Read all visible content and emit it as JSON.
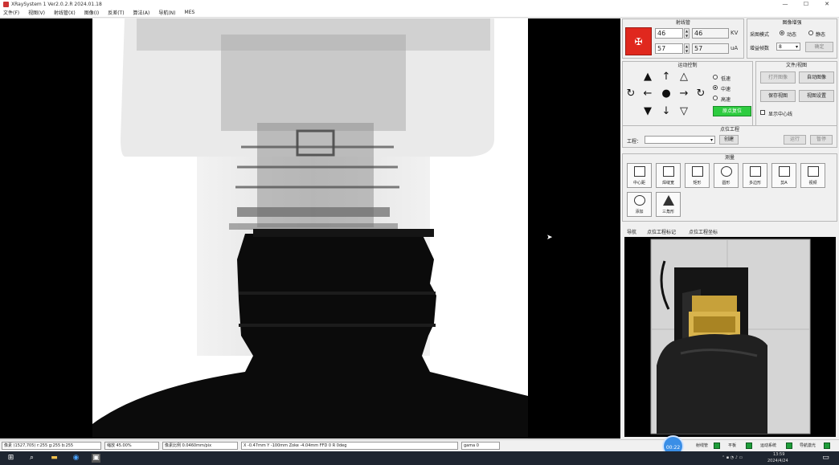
{
  "window": {
    "title": "XRaySystem 1 Ver2.0.2.R 2024.01.18",
    "minimize": "—",
    "maximize": "☐",
    "close": "✕"
  },
  "menu": [
    "文件(F)",
    "视图(V)",
    "射线管(X)",
    "图像(I)",
    "反差(T)",
    "算法(A)",
    "导航(N)",
    "MES"
  ],
  "tube": {
    "title": "射线管",
    "kv_set": "46",
    "kv_actual": "46",
    "kv_unit": "KV",
    "ua_set": "57",
    "ua_actual": "57",
    "ua_unit": "uA",
    "xray_symbol": "✠"
  },
  "image_enhance": {
    "title": "图像增强",
    "mode_label": "采图模式",
    "mode_dynamic": "动态",
    "mode_static": "静态",
    "frames_label": "增益帧数",
    "frames_value": "8",
    "apply_label": "确定"
  },
  "motion": {
    "title": "运动控制",
    "speed_slow": "低速",
    "speed_mid": "中速",
    "speed_high": "高速",
    "reset_label": "原点复位"
  },
  "file_view": {
    "title": "文件/视图",
    "open_image": "打开图像",
    "auto_save": "自动图像",
    "save_image": "保存视图",
    "view_settings": "视图设置",
    "show_center": "显示中心线"
  },
  "project": {
    "title": "点位工程",
    "label": "工程：",
    "create": "创建",
    "load": "运行",
    "stop": "暂停"
  },
  "measure": {
    "title": "测量",
    "tools": [
      "中心距",
      "焊缝宽",
      "矩形",
      "圆形",
      "多边形",
      "剪A",
      "视频",
      "添加",
      "三角形"
    ]
  },
  "tabs": [
    "导航",
    "点位工程标记",
    "点位工程坐标"
  ],
  "status": {
    "pixel": "像素 (1527,705) r:255 g:255 b:255",
    "zoom": "缩放 45.00%",
    "scale": "像素比例 0.0460mm/pix",
    "coords": "X -0.47mm  Y -100mm  Zoke -4.04mm  FFD 0  R 0deg",
    "gamma": "gama 0",
    "badge": "00:22",
    "lamps": [
      "射线管",
      "平板",
      "运动系统",
      "导航激光"
    ]
  },
  "taskbar": {
    "time": "13:59",
    "date": "2024/4/24"
  }
}
